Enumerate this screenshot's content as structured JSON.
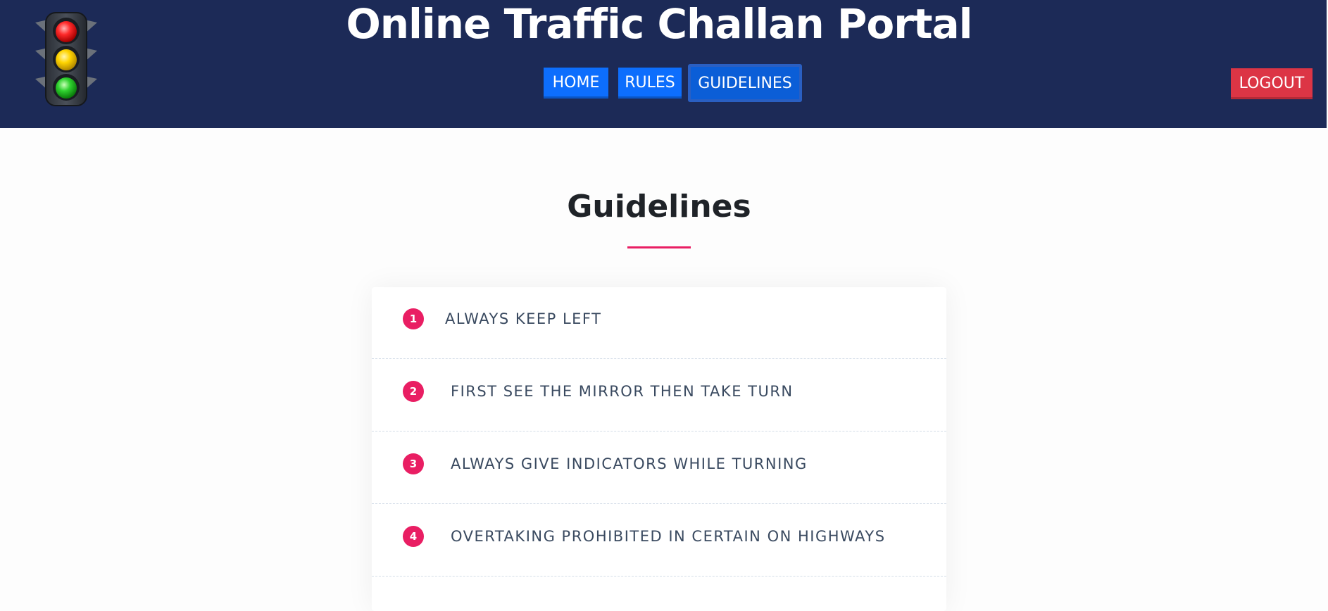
{
  "header": {
    "title": "Online Traffic Challan Portal",
    "logo_icon": "traffic-light-icon",
    "background": "#1c2a57"
  },
  "nav": {
    "home": "HOME",
    "rules": "RULES",
    "guidelines": "GUIDELINES",
    "active": "GUIDELINES",
    "accent": "#0d6efd"
  },
  "logout": {
    "label": "LOGOUT",
    "color": "#dc3545"
  },
  "main": {
    "section_title": "Guidelines",
    "accent": "#e91e63",
    "guidelines": [
      {
        "number": "1",
        "text": "ALWAYS KEEP LEFT"
      },
      {
        "number": "2",
        "text": "FIRST SEE THE MIRROR THEN TAKE TURN"
      },
      {
        "number": "3",
        "text": "ALWAYS GIVE INDICATORS WHILE TURNING"
      },
      {
        "number": "4",
        "text": "OVERTAKING PROHIBITED IN CERTAIN ON HIGHWAYS"
      }
    ]
  }
}
